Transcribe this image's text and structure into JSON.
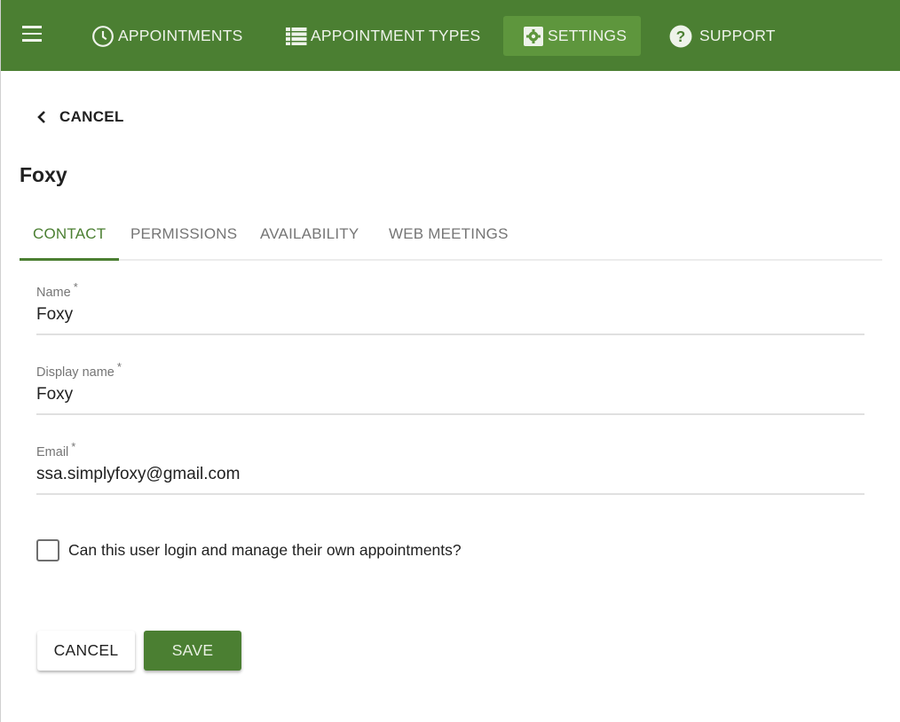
{
  "colors": {
    "brand": "#4b7f32",
    "nav_active_bg": "#5e963d",
    "text": "#212121",
    "muted": "#757575"
  },
  "topbar": {
    "menu_icon": "hamburger-menu-icon",
    "nav": [
      {
        "label": "APPOINTMENTS",
        "icon": "clock-icon",
        "active": false
      },
      {
        "label": "APPOINTMENT TYPES",
        "icon": "list-icon",
        "active": false
      },
      {
        "label": "SETTINGS",
        "icon": "gear-icon",
        "active": true
      },
      {
        "label": "SUPPORT",
        "icon": "help-circle-icon",
        "active": false
      }
    ]
  },
  "back": {
    "label": "CANCEL",
    "icon": "chevron-left-icon"
  },
  "page": {
    "title": "Foxy"
  },
  "tabs": [
    {
      "label": "CONTACT",
      "active": true
    },
    {
      "label": "PERMISSIONS",
      "active": false
    },
    {
      "label": "AVAILABILITY",
      "active": false
    },
    {
      "label": "WEB MEETINGS",
      "active": false
    }
  ],
  "form": {
    "name": {
      "label": "Name",
      "required_mark": "*",
      "value": "Foxy"
    },
    "display_name": {
      "label": "Display name",
      "required_mark": "*",
      "value": "Foxy"
    },
    "email": {
      "label": "Email",
      "required_mark": "*",
      "value": "ssa.simplyfoxy@gmail.com"
    },
    "self_manage": {
      "label": "Can this user login and manage their own appointments?",
      "checked": false
    }
  },
  "actions": {
    "cancel_label": "CANCEL",
    "save_label": "SAVE"
  }
}
